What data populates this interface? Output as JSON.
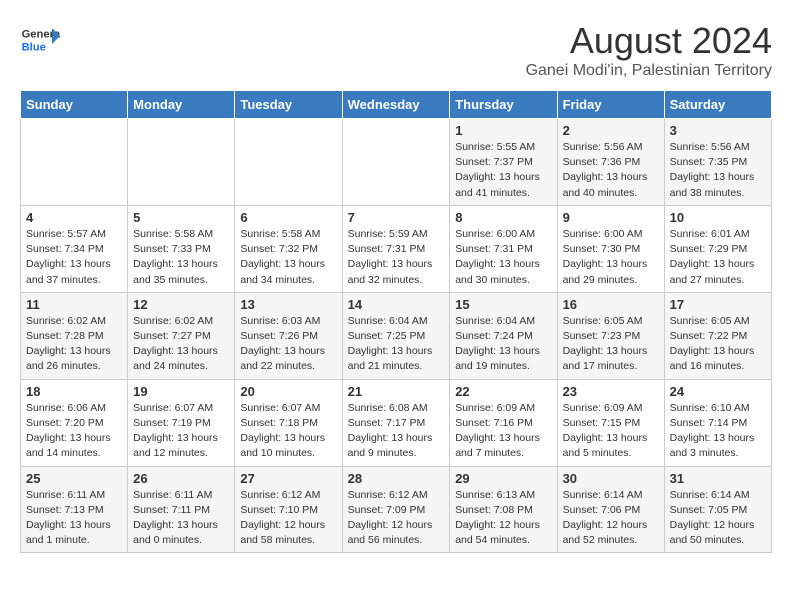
{
  "header": {
    "logo_line1": "General",
    "logo_line2": "Blue",
    "main_title": "August 2024",
    "subtitle": "Ganei Modi'in, Palestinian Territory"
  },
  "weekdays": [
    "Sunday",
    "Monday",
    "Tuesday",
    "Wednesday",
    "Thursday",
    "Friday",
    "Saturday"
  ],
  "weeks": [
    [
      {
        "day": "",
        "info": ""
      },
      {
        "day": "",
        "info": ""
      },
      {
        "day": "",
        "info": ""
      },
      {
        "day": "",
        "info": ""
      },
      {
        "day": "1",
        "info": "Sunrise: 5:55 AM\nSunset: 7:37 PM\nDaylight: 13 hours\nand 41 minutes."
      },
      {
        "day": "2",
        "info": "Sunrise: 5:56 AM\nSunset: 7:36 PM\nDaylight: 13 hours\nand 40 minutes."
      },
      {
        "day": "3",
        "info": "Sunrise: 5:56 AM\nSunset: 7:35 PM\nDaylight: 13 hours\nand 38 minutes."
      }
    ],
    [
      {
        "day": "4",
        "info": "Sunrise: 5:57 AM\nSunset: 7:34 PM\nDaylight: 13 hours\nand 37 minutes."
      },
      {
        "day": "5",
        "info": "Sunrise: 5:58 AM\nSunset: 7:33 PM\nDaylight: 13 hours\nand 35 minutes."
      },
      {
        "day": "6",
        "info": "Sunrise: 5:58 AM\nSunset: 7:32 PM\nDaylight: 13 hours\nand 34 minutes."
      },
      {
        "day": "7",
        "info": "Sunrise: 5:59 AM\nSunset: 7:31 PM\nDaylight: 13 hours\nand 32 minutes."
      },
      {
        "day": "8",
        "info": "Sunrise: 6:00 AM\nSunset: 7:31 PM\nDaylight: 13 hours\nand 30 minutes."
      },
      {
        "day": "9",
        "info": "Sunrise: 6:00 AM\nSunset: 7:30 PM\nDaylight: 13 hours\nand 29 minutes."
      },
      {
        "day": "10",
        "info": "Sunrise: 6:01 AM\nSunset: 7:29 PM\nDaylight: 13 hours\nand 27 minutes."
      }
    ],
    [
      {
        "day": "11",
        "info": "Sunrise: 6:02 AM\nSunset: 7:28 PM\nDaylight: 13 hours\nand 26 minutes."
      },
      {
        "day": "12",
        "info": "Sunrise: 6:02 AM\nSunset: 7:27 PM\nDaylight: 13 hours\nand 24 minutes."
      },
      {
        "day": "13",
        "info": "Sunrise: 6:03 AM\nSunset: 7:26 PM\nDaylight: 13 hours\nand 22 minutes."
      },
      {
        "day": "14",
        "info": "Sunrise: 6:04 AM\nSunset: 7:25 PM\nDaylight: 13 hours\nand 21 minutes."
      },
      {
        "day": "15",
        "info": "Sunrise: 6:04 AM\nSunset: 7:24 PM\nDaylight: 13 hours\nand 19 minutes."
      },
      {
        "day": "16",
        "info": "Sunrise: 6:05 AM\nSunset: 7:23 PM\nDaylight: 13 hours\nand 17 minutes."
      },
      {
        "day": "17",
        "info": "Sunrise: 6:05 AM\nSunset: 7:22 PM\nDaylight: 13 hours\nand 16 minutes."
      }
    ],
    [
      {
        "day": "18",
        "info": "Sunrise: 6:06 AM\nSunset: 7:20 PM\nDaylight: 13 hours\nand 14 minutes."
      },
      {
        "day": "19",
        "info": "Sunrise: 6:07 AM\nSunset: 7:19 PM\nDaylight: 13 hours\nand 12 minutes."
      },
      {
        "day": "20",
        "info": "Sunrise: 6:07 AM\nSunset: 7:18 PM\nDaylight: 13 hours\nand 10 minutes."
      },
      {
        "day": "21",
        "info": "Sunrise: 6:08 AM\nSunset: 7:17 PM\nDaylight: 13 hours\nand 9 minutes."
      },
      {
        "day": "22",
        "info": "Sunrise: 6:09 AM\nSunset: 7:16 PM\nDaylight: 13 hours\nand 7 minutes."
      },
      {
        "day": "23",
        "info": "Sunrise: 6:09 AM\nSunset: 7:15 PM\nDaylight: 13 hours\nand 5 minutes."
      },
      {
        "day": "24",
        "info": "Sunrise: 6:10 AM\nSunset: 7:14 PM\nDaylight: 13 hours\nand 3 minutes."
      }
    ],
    [
      {
        "day": "25",
        "info": "Sunrise: 6:11 AM\nSunset: 7:13 PM\nDaylight: 13 hours\nand 1 minute."
      },
      {
        "day": "26",
        "info": "Sunrise: 6:11 AM\nSunset: 7:11 PM\nDaylight: 13 hours\nand 0 minutes."
      },
      {
        "day": "27",
        "info": "Sunrise: 6:12 AM\nSunset: 7:10 PM\nDaylight: 12 hours\nand 58 minutes."
      },
      {
        "day": "28",
        "info": "Sunrise: 6:12 AM\nSunset: 7:09 PM\nDaylight: 12 hours\nand 56 minutes."
      },
      {
        "day": "29",
        "info": "Sunrise: 6:13 AM\nSunset: 7:08 PM\nDaylight: 12 hours\nand 54 minutes."
      },
      {
        "day": "30",
        "info": "Sunrise: 6:14 AM\nSunset: 7:06 PM\nDaylight: 12 hours\nand 52 minutes."
      },
      {
        "day": "31",
        "info": "Sunrise: 6:14 AM\nSunset: 7:05 PM\nDaylight: 12 hours\nand 50 minutes."
      }
    ]
  ]
}
